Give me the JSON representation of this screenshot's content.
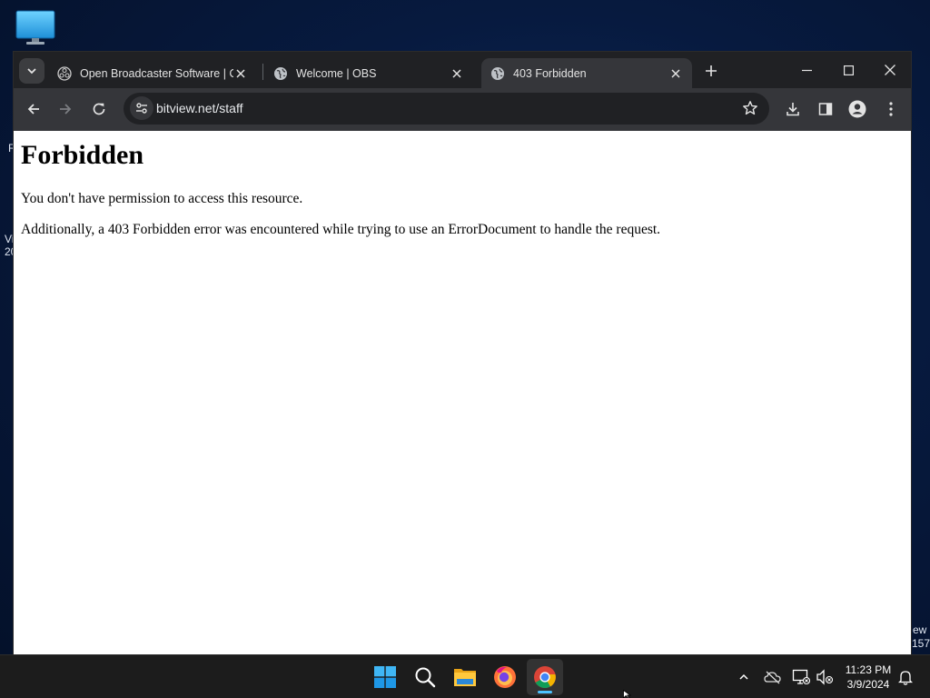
{
  "desktop": {
    "icon": "monitor-icon",
    "peek_left": [
      "R",
      "Vi",
      "20"
    ],
    "peek_right": [
      "ew",
      "157"
    ]
  },
  "browser": {
    "tabs": [
      {
        "title": "Open Broadcaster Software | OBS",
        "favicon": "obs-logo-icon",
        "active": false
      },
      {
        "title": "Welcome | OBS",
        "favicon": "globe-icon",
        "active": false
      },
      {
        "title": "403 Forbidden",
        "favicon": "globe-icon",
        "active": true
      }
    ],
    "toolbar": {
      "url": "bitview.net/staff"
    },
    "page": {
      "heading": "Forbidden",
      "paragraphs": [
        "You don't have permission to access this resource.",
        "Additionally, a 403 Forbidden error was encountered while trying to use an ErrorDocument to handle the request."
      ]
    },
    "colors": {
      "tabstrip": "#202124",
      "toolbar": "#35363a",
      "active_tab": "#35363a"
    }
  },
  "taskbar": {
    "apps": [
      "start-icon",
      "search-icon",
      "file-explorer-icon",
      "firefox-icon",
      "chrome-icon"
    ],
    "active_app": "chrome-icon",
    "clock": {
      "time": "11:23 PM",
      "date": "3/9/2024"
    },
    "tray_icons": [
      "chevron-up-icon",
      "onedrive-icon",
      "network-icon",
      "volume-muted-icon",
      "notification-bell-icon"
    ]
  }
}
